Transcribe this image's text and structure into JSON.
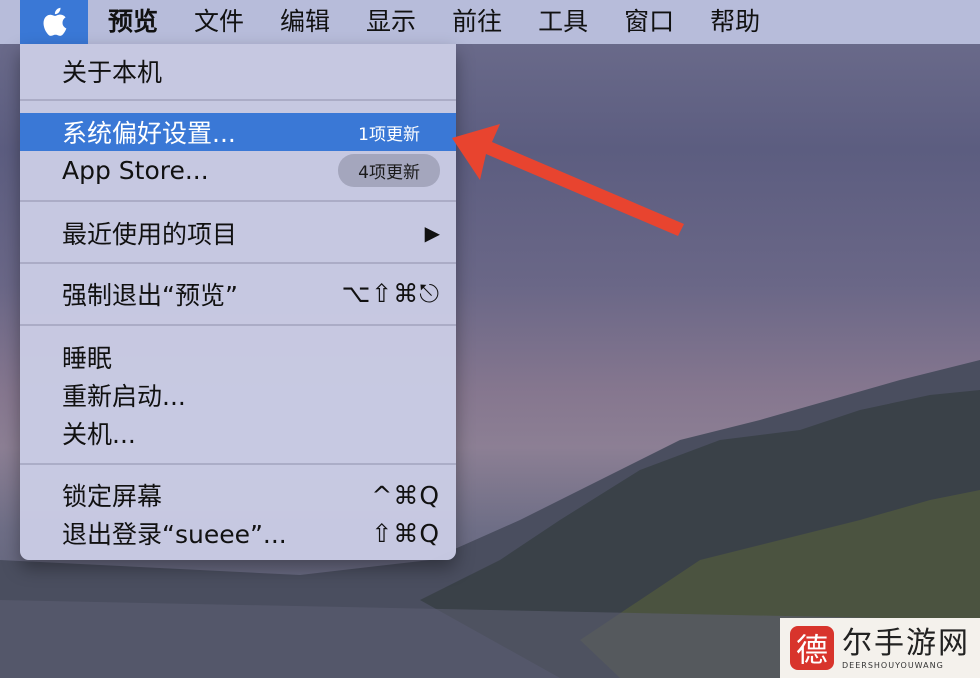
{
  "menubar": {
    "items": [
      "预览",
      "文件",
      "编辑",
      "显示",
      "前往",
      "工具",
      "窗口",
      "帮助"
    ]
  },
  "apple_menu": {
    "about": "关于本机",
    "system_prefs": {
      "label": "系统偏好设置...",
      "badge": "1项更新"
    },
    "app_store": {
      "label": "App Store...",
      "badge": "4项更新"
    },
    "recent_items": {
      "label": "最近使用的项目",
      "arrow": "▶"
    },
    "force_quit": {
      "label": "强制退出“预览”",
      "shortcut": "⌥⇧⌘⎋"
    },
    "sleep": "睡眠",
    "restart": "重新启动...",
    "shutdown": "关机...",
    "lock_screen": {
      "label": "锁定屏幕",
      "shortcut": "^⌘Q"
    },
    "logout": {
      "label": "退出登录“sueee”...",
      "shortcut": "⇧⌘Q"
    }
  },
  "watermark": {
    "logo_char": "德",
    "main": "尔手游网",
    "sub": "DEERSHOUYOUWANG"
  },
  "colors": {
    "selection": "#3a78d6",
    "annotation_arrow": "#e8442f"
  },
  "icons": [
    "apple-logo-icon",
    "submenu-arrow-icon",
    "annotation-arrow-icon"
  ]
}
